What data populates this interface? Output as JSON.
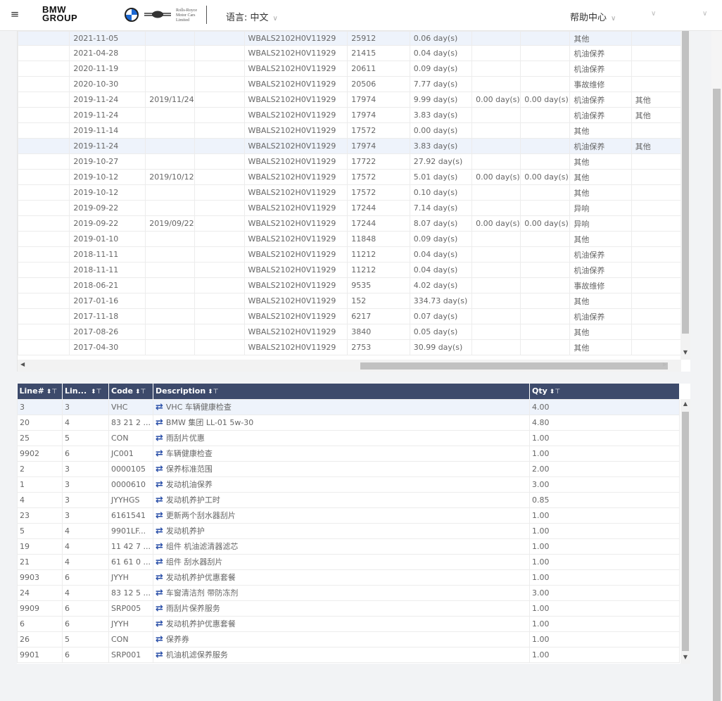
{
  "header": {
    "menu_icon": "menu-indent-icon",
    "logo_line1": "BMW",
    "logo_line2": "GROUP",
    "rolls_royce_text": "Rolls-Royce Motor Cars Limited",
    "language_label": "语言: 中文",
    "help_label": "帮助中心"
  },
  "upper_table": {
    "rows": [
      [
        "",
        "2021-11-05",
        "",
        "",
        "WBALS2102H0V11929",
        "25912",
        "0.06 day(s)",
        "",
        "",
        "其他",
        ""
      ],
      [
        "",
        "2021-04-28",
        "",
        "",
        "WBALS2102H0V11929",
        "21415",
        "0.04 day(s)",
        "",
        "",
        "机油保养",
        ""
      ],
      [
        "",
        "2020-11-19",
        "",
        "",
        "WBALS2102H0V11929",
        "20611",
        "0.09 day(s)",
        "",
        "",
        "机油保养",
        ""
      ],
      [
        "",
        "2020-10-30",
        "",
        "",
        "WBALS2102H0V11929",
        "20506",
        "7.77 day(s)",
        "",
        "",
        "事故维修",
        ""
      ],
      [
        "",
        "2019-11-24",
        "2019/11/24",
        "",
        "WBALS2102H0V11929",
        "17974",
        "9.99 day(s)",
        "0.00 day(s)",
        "0.00 day(s)",
        "机油保养",
        "其他"
      ],
      [
        "",
        "2019-11-24",
        "",
        "",
        "WBALS2102H0V11929",
        "17974",
        "3.83 day(s)",
        "",
        "",
        "机油保养",
        "其他"
      ],
      [
        "",
        "2019-11-14",
        "",
        "",
        "WBALS2102H0V11929",
        "17572",
        "0.00 day(s)",
        "",
        "",
        "其他",
        ""
      ],
      [
        "",
        "2019-11-24",
        "",
        "",
        "WBALS2102H0V11929",
        "17974",
        "3.83 day(s)",
        "",
        "",
        "机油保养",
        "其他"
      ],
      [
        "",
        "2019-10-27",
        "",
        "",
        "WBALS2102H0V11929",
        "17722",
        "27.92 day(s)",
        "",
        "",
        "其他",
        ""
      ],
      [
        "",
        "2019-10-12",
        "2019/10/12",
        "",
        "WBALS2102H0V11929",
        "17572",
        "5.01 day(s)",
        "0.00 day(s)",
        "0.00 day(s)",
        "其他",
        ""
      ],
      [
        "",
        "2019-10-12",
        "",
        "",
        "WBALS2102H0V11929",
        "17572",
        "0.10 day(s)",
        "",
        "",
        "其他",
        ""
      ],
      [
        "",
        "2019-09-22",
        "",
        "",
        "WBALS2102H0V11929",
        "17244",
        "7.14 day(s)",
        "",
        "",
        "异响",
        ""
      ],
      [
        "",
        "2019-09-22",
        "2019/09/22",
        "",
        "WBALS2102H0V11929",
        "17244",
        "8.07 day(s)",
        "0.00 day(s)",
        "0.00 day(s)",
        "异响",
        ""
      ],
      [
        "",
        "2019-01-10",
        "",
        "",
        "WBALS2102H0V11929",
        "11848",
        "0.09 day(s)",
        "",
        "",
        "其他",
        ""
      ],
      [
        "",
        "2018-11-11",
        "",
        "",
        "WBALS2102H0V11929",
        "11212",
        "0.04 day(s)",
        "",
        "",
        "机油保养",
        ""
      ],
      [
        "",
        "2018-11-11",
        "",
        "",
        "WBALS2102H0V11929",
        "11212",
        "0.04 day(s)",
        "",
        "",
        "机油保养",
        ""
      ],
      [
        "",
        "2018-06-21",
        "",
        "",
        "WBALS2102H0V11929",
        "9535",
        "4.02 day(s)",
        "",
        "",
        "事故维修",
        ""
      ],
      [
        "",
        "2017-01-16",
        "",
        "",
        "WBALS2102H0V11929",
        "152",
        "334.73 day(s)",
        "",
        "",
        "其他",
        ""
      ],
      [
        "",
        "2017-11-18",
        "",
        "",
        "WBALS2102H0V11929",
        "6217",
        "0.07 day(s)",
        "",
        "",
        "机油保养",
        ""
      ],
      [
        "",
        "2017-08-26",
        "",
        "",
        "WBALS2102H0V11929",
        "3840",
        "0.05 day(s)",
        "",
        "",
        "其他",
        ""
      ],
      [
        "",
        "2017-04-30",
        "",
        "",
        "WBALS2102H0V11929",
        "2753",
        "30.99 day(s)",
        "",
        "",
        "其他",
        ""
      ]
    ]
  },
  "lower_table": {
    "headers": [
      "Line#",
      "Lin...",
      "Code",
      "Description",
      "Qty"
    ],
    "rows": [
      [
        "3",
        "3",
        "VHC",
        "VHC 车辆健康检查",
        "4.00"
      ],
      [
        "20",
        "4",
        "83 21 2 ...",
        "BMW 集团 LL-01 5w-30",
        "4.80"
      ],
      [
        "25",
        "5",
        "CON",
        "雨刮片优惠",
        "1.00"
      ],
      [
        "9902",
        "6",
        "JC001",
        "车辆健康检查",
        "1.00"
      ],
      [
        "2",
        "3",
        "0000105",
        "保养标准范围",
        "2.00"
      ],
      [
        "1",
        "3",
        "0000610",
        "发动机油保养",
        "3.00"
      ],
      [
        "4",
        "3",
        "JYYHGS",
        "发动机养护工时",
        "0.85"
      ],
      [
        "23",
        "3",
        "6161541",
        "更新两个刮水器刮片",
        "1.00"
      ],
      [
        "5",
        "4",
        "9901LF...",
        "发动机养护",
        "1.00"
      ],
      [
        "19",
        "4",
        "11 42 7 ...",
        "组件 机油滤清器滤芯",
        "1.00"
      ],
      [
        "21",
        "4",
        "61 61 0 ...",
        "组件 刮水器刮片",
        "1.00"
      ],
      [
        "9903",
        "6",
        "JYYH",
        "发动机养护优惠套餐",
        "1.00"
      ],
      [
        "24",
        "4",
        "83 12 5 ...",
        "车窗清洁剂 带防冻剂",
        "3.00"
      ],
      [
        "9909",
        "6",
        "SRP005",
        "雨刮片保养服务",
        "1.00"
      ],
      [
        "6",
        "6",
        "JYYH",
        "发动机养护优惠套餐",
        "1.00"
      ],
      [
        "26",
        "5",
        "CON",
        "保养券",
        "1.00"
      ],
      [
        "9901",
        "6",
        "SRP001",
        "机油机滤保养服务",
        "1.00"
      ]
    ]
  }
}
